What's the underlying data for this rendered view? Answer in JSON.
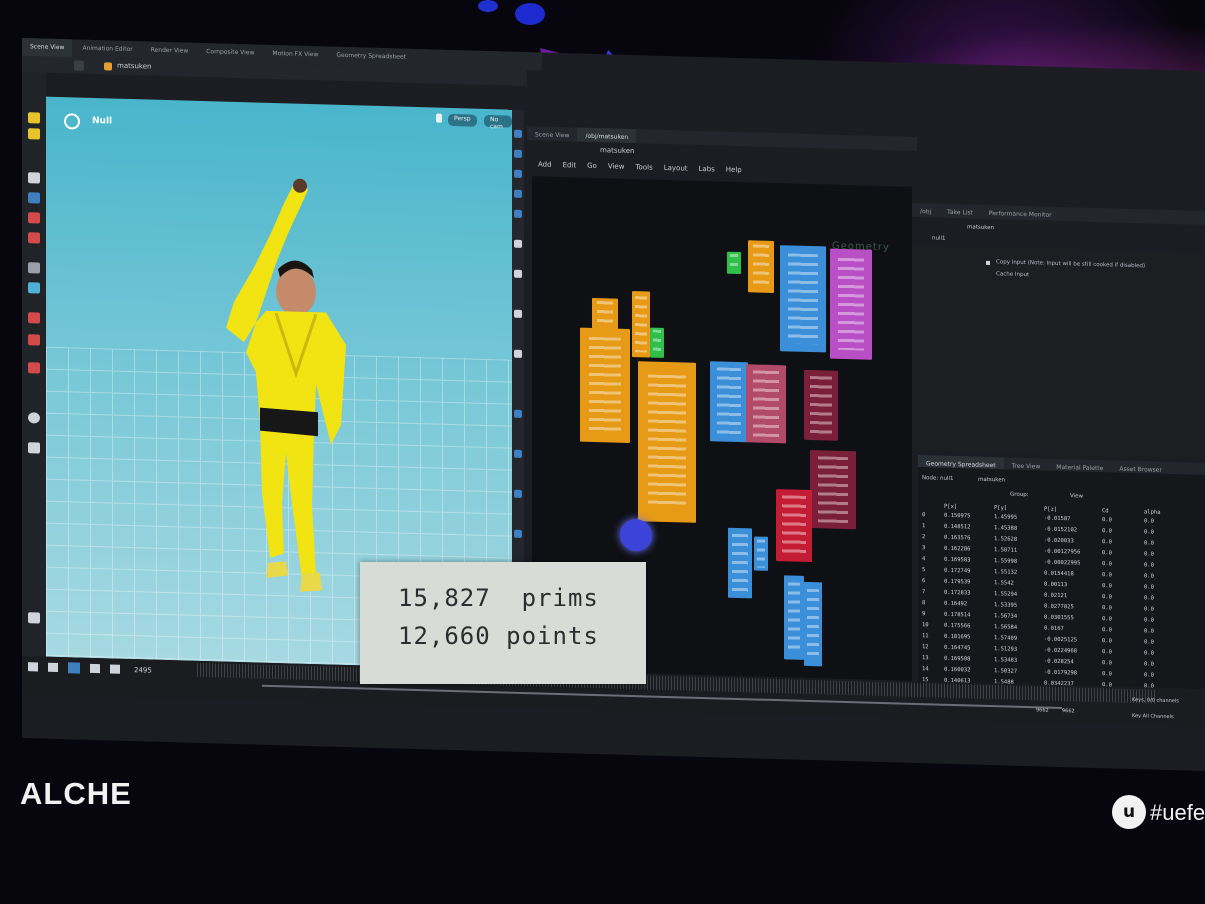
{
  "houdini": {
    "viewport_tabs": [
      "Scene View",
      "Animation Editor",
      "Render View",
      "Composite View",
      "Motion FX View",
      "Geometry Spreadsheet"
    ],
    "viewport_path": "matsuken",
    "viewport_label": "Null",
    "viewport_buttons": [
      "Persp",
      "No cam"
    ],
    "network_tabs": [
      "Scene View",
      "/obj/matsuken"
    ],
    "network_path": "matsuken",
    "network_menu": [
      "Add",
      "Edit",
      "Go",
      "View",
      "Tools",
      "Layout",
      "Labs",
      "Help"
    ],
    "network_context_label": "Geometry",
    "param_tabs": [
      "/obj",
      "Take List",
      "Performance Monitor"
    ],
    "param_node": "null1",
    "param_path": "matsuken",
    "param_lines": [
      "Copy Input (Note: Input will be still cooked if disabled)",
      "Cache Input"
    ],
    "sheet_tabs": [
      "Geometry Spreadsheet",
      "Tree View",
      "Material Palette",
      "Asset Browser"
    ],
    "sheet_node_label": "Node: null1",
    "sheet_path": "matsuken",
    "sheet_group_label": "Group:",
    "sheet_view_label": "View",
    "sheet_columns": [
      "",
      "P[x]",
      "P[y]",
      "P[z]",
      "Cd",
      "alpha"
    ],
    "sheet_rows": [
      [
        "0",
        "0.150975",
        "1.45995",
        "-0.01587",
        "0.0",
        "0.0"
      ],
      [
        "1",
        "0.148512",
        "1.45388",
        "-0.0152102",
        "0.0",
        "0.0"
      ],
      [
        "2",
        "0.163576",
        "1.52628",
        "-0.020033",
        "0.0",
        "0.0"
      ],
      [
        "3",
        "0.162286",
        "1.50711",
        "-0.00127956",
        "0.0",
        "0.0"
      ],
      [
        "4",
        "0.169583",
        "1.55998",
        "-0.00022995",
        "0.0",
        "0.0"
      ],
      [
        "5",
        "0.172749",
        "1.55132",
        "0.0154418",
        "0.0",
        "0.0"
      ],
      [
        "6",
        "0.179539",
        "1.5542",
        "0.00113",
        "0.0",
        "0.0"
      ],
      [
        "7",
        "0.172833",
        "1.55294",
        "0.02121",
        "0.0",
        "0.0"
      ],
      [
        "8",
        "0.16492",
        "1.53395",
        "0.0277825",
        "0.0",
        "0.0"
      ],
      [
        "9",
        "0.178514",
        "1.56734",
        "0.0301555",
        "0.0",
        "0.0"
      ],
      [
        "10",
        "0.175566",
        "1.56584",
        "0.0167",
        "0.0",
        "0.0"
      ],
      [
        "11",
        "0.181695",
        "1.57409",
        "-0.0025125",
        "0.0",
        "0.0"
      ],
      [
        "12",
        "0.164745",
        "1.51293",
        "-0.0224968",
        "0.0",
        "0.0"
      ],
      [
        "13",
        "0.169508",
        "1.53483",
        "-0.028254",
        "0.0",
        "0.0"
      ],
      [
        "14",
        "0.160032",
        "1.50327",
        "-0.0179298",
        "0.0",
        "0.0"
      ],
      [
        "15",
        "0.140613",
        "1.5488",
        "0.0342237",
        "0.0",
        "0.0"
      ]
    ],
    "timeline_frame": "2495",
    "timeline_end": [
      "9662",
      "9662"
    ],
    "channel_buttons": [
      "Keys, 0/0 channels",
      "Key All Channels"
    ]
  },
  "overlay": {
    "prims": "15,827  prims",
    "points": "12,660 points"
  },
  "event": {
    "logo": "ALCHE",
    "badge": "u",
    "hashtag": "#uefes"
  },
  "colors": {
    "node_orange": "#e69a16",
    "node_blue": "#3b8fd9",
    "node_magenta": "#b84fc4",
    "node_red": "#c41c34",
    "node_maroon": "#7a1f3a",
    "node_green": "#2fbf4a"
  }
}
